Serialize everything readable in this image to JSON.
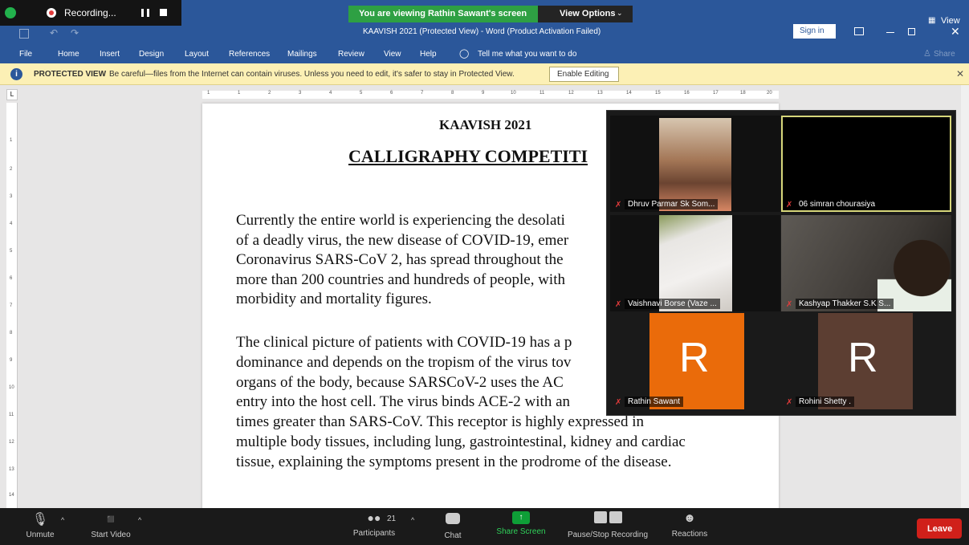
{
  "zoom_header": {
    "recording_label": "Recording...",
    "viewing_banner": "You are viewing Rathin Sawant's screen",
    "view_options": "View Options",
    "view_label": "View"
  },
  "word": {
    "window_title": "KAAVISH 2021 (Protected View) - Word (Product Activation Failed)",
    "sign_in": "Sign in",
    "tabs": [
      "File",
      "Home",
      "Insert",
      "Design",
      "Layout",
      "References",
      "Mailings",
      "Review",
      "View",
      "Help"
    ],
    "tell_me": "Tell me what you want to do",
    "share": "Share",
    "protected_title": "PROTECTED VIEW",
    "protected_msg": "Be careful—files from the Internet can contain viruses. Unless you need to edit, it's safer to stay in Protected View.",
    "enable_editing": "Enable Editing",
    "ruler_marks": [
      "1",
      "1",
      "2",
      "3",
      "4",
      "5",
      "6",
      "7",
      "8",
      "9",
      "10",
      "11",
      "12",
      "13",
      "14",
      "15",
      "16",
      "17",
      "18",
      "20"
    ],
    "vruler_marks": [
      "1",
      "2",
      "3",
      "4",
      "5",
      "6",
      "7",
      "8",
      "9",
      "10",
      "11",
      "12",
      "13",
      "14"
    ]
  },
  "document": {
    "heading1": "KAAVISH 2021",
    "heading2": "CALLIGRAPHY COMPETITI",
    "para1_lines": [
      "Currently the entire world is experiencing the desolati",
      "of a deadly virus, the new disease of COVID-19, emer",
      "Coronavirus SARS-CoV 2, has spread throughout the",
      "more than 200 countries and hundreds of people, with",
      "morbidity and mortality figures."
    ],
    "para2_lines": [
      "The clinical picture of patients with COVID-19 has a p",
      "dominance and depends on the tropism of the virus tov",
      "organs of the body, because SARSCoV-2 uses the AC",
      "entry into the host cell. The virus binds ACE-2 with an",
      "times greater than SARS-CoV. This receptor is highly expressed in",
      "multiple body tissues, including lung, gastrointestinal, kidney and cardiac",
      "tissue, explaining the symptoms present in the prodrome of the disease."
    ]
  },
  "gallery": {
    "participants": [
      {
        "name": "Dhruv Parmar Sk Som...",
        "kind": "video"
      },
      {
        "name": "06 simran chourasiya",
        "kind": "black",
        "active": true
      },
      {
        "name": "Vaishnavi Borse (Vaze ...",
        "kind": "video"
      },
      {
        "name": "Kashyap Thakker S.K S...",
        "kind": "video"
      },
      {
        "name": "Rathin Sawant",
        "kind": "avatar",
        "initial": "R",
        "color": "#ea6b0a"
      },
      {
        "name": "Rohini Shetty .",
        "kind": "avatar",
        "initial": "R",
        "color": "#5c3e32"
      }
    ]
  },
  "toolbar": {
    "unmute": "Unmute",
    "start_video": "Start Video",
    "participants": "Participants",
    "participant_count": "21",
    "chat": "Chat",
    "share_screen": "Share Screen",
    "pause_stop": "Pause/Stop Recording",
    "reactions": "Reactions",
    "leave": "Leave"
  },
  "colors": {
    "word_blue": "#2b579a",
    "zoom_green": "#0e9f37",
    "leave_red": "#d0201a",
    "banner_green": "#2ea043"
  }
}
